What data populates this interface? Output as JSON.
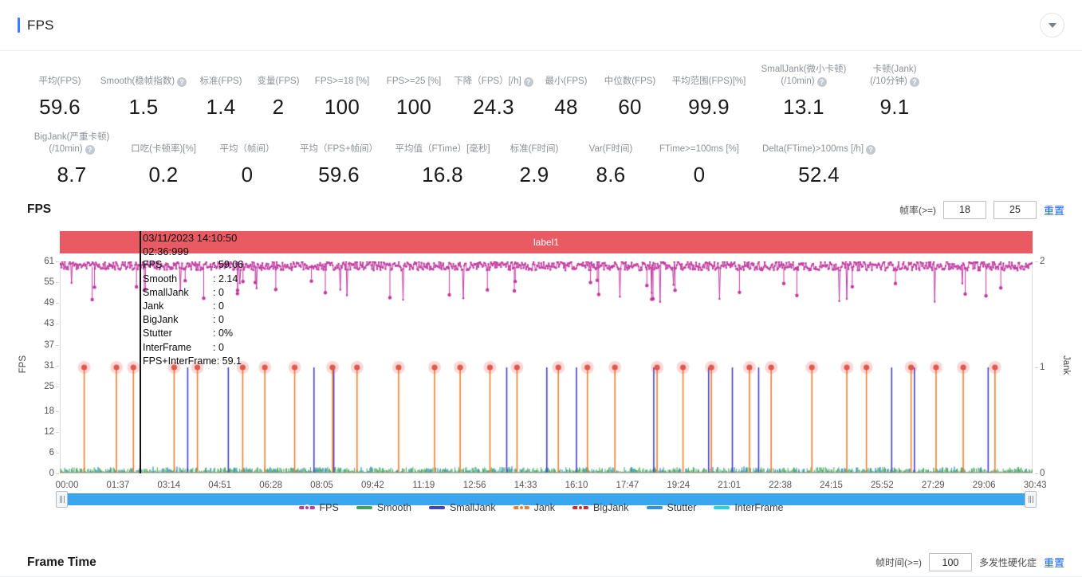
{
  "header": {
    "title": "FPS",
    "collapse_icon": "chevron-down-icon"
  },
  "stats": {
    "row1": [
      {
        "label_lines": [
          "平均(FPS)"
        ],
        "help": false,
        "value": "59.6"
      },
      {
        "label_lines": [
          "Smooth(稳帧指数)"
        ],
        "help": true,
        "value": "1.5"
      },
      {
        "label_lines": [
          "标准(FPS)"
        ],
        "help": false,
        "value": "1.4"
      },
      {
        "label_lines": [
          "变量(FPS)"
        ],
        "help": false,
        "value": "2"
      },
      {
        "label_lines": [
          "FPS>=18 [%]"
        ],
        "help": false,
        "value": "100"
      },
      {
        "label_lines": [
          "FPS>=25 [%]"
        ],
        "help": false,
        "value": "100"
      },
      {
        "label_lines": [
          "下降（FPS）[/h]"
        ],
        "help": true,
        "value": "24.3"
      },
      {
        "label_lines": [
          "最小(FPS)"
        ],
        "help": false,
        "value": "48"
      },
      {
        "label_lines": [
          "中位数(FPS)"
        ],
        "help": false,
        "value": "60"
      },
      {
        "label_lines": [
          "平均范围(FPS)[%]"
        ],
        "help": false,
        "value": "99.9"
      },
      {
        "label_lines": [
          "SmallJank(微小卡顿)",
          "(/10min)"
        ],
        "help": true,
        "value": "13.1"
      },
      {
        "label_lines": [
          "卡顿(Jank)",
          "(/10分钟)"
        ],
        "help": true,
        "value": "9.1"
      }
    ],
    "row2": [
      {
        "label_lines": [
          "BigJank(严重卡顿)",
          "(/10min)"
        ],
        "help": true,
        "value": "8.7"
      },
      {
        "label_lines": [
          "口吃(卡顿率)[%]"
        ],
        "help": false,
        "value": "0.2"
      },
      {
        "label_lines": [
          "平均（帧间）"
        ],
        "help": false,
        "value": "0"
      },
      {
        "label_lines": [
          "平均（FPS+帧间）"
        ],
        "help": false,
        "value": "59.6"
      },
      {
        "label_lines": [
          "平均值（FTime）[毫秒]"
        ],
        "help": false,
        "value": "16.8"
      },
      {
        "label_lines": [
          "标准(F时间)"
        ],
        "help": false,
        "value": "2.9"
      },
      {
        "label_lines": [
          "Var(F时间)"
        ],
        "help": false,
        "value": "8.6"
      },
      {
        "label_lines": [
          "FTime>=100ms [%]"
        ],
        "help": false,
        "value": "0"
      },
      {
        "label_lines": [
          "Delta(FTime)>100ms [/h]"
        ],
        "help": true,
        "value": "52.4"
      }
    ]
  },
  "fps_chart": {
    "section_title": "FPS",
    "filter_label": "帧率(>=)",
    "filter_value_1": "18",
    "filter_value_2": "25",
    "reset_label": "重置",
    "band_label": "label1",
    "tooltip": {
      "datetime": "03/11/2023 14:10:50",
      "elapsed": "02:36:999",
      "rows": [
        {
          "key": "FPS",
          "value": "59.06"
        },
        {
          "key": "Smooth",
          "value": "2.14"
        },
        {
          "key": "SmallJank",
          "value": "0"
        },
        {
          "key": "Jank",
          "value": "0"
        },
        {
          "key": "BigJank",
          "value": "0"
        },
        {
          "key": "Stutter",
          "value": "0%"
        },
        {
          "key": "InterFrame",
          "value": "0"
        }
      ],
      "last_row": "FPS+InterFrame: 59.1"
    },
    "legend": [
      {
        "name": "FPS",
        "color": "#c0399f",
        "style": "dot"
      },
      {
        "name": "Smooth",
        "color": "#3da35d",
        "style": "line"
      },
      {
        "name": "SmallJank",
        "color": "#4241c9",
        "style": "line"
      },
      {
        "name": "Jank",
        "color": "#f08030",
        "style": "dot"
      },
      {
        "name": "BigJank",
        "color": "#d12b2b",
        "style": "dot"
      },
      {
        "name": "Stutter",
        "color": "#2e93e8",
        "style": "line"
      },
      {
        "name": "InterFrame",
        "color": "#21d3e8",
        "style": "line"
      }
    ]
  },
  "frame_time": {
    "section_title": "Frame Time",
    "filter_label": "帧时间(>=)",
    "filter_value": "100",
    "ms_label": "多发性硬化症",
    "reset_label": "重置"
  },
  "chart_data": {
    "type": "line",
    "title": "FPS",
    "xlabel": "",
    "ylabel": "FPS",
    "y2label": "Jank",
    "ylim": [
      0,
      61
    ],
    "y2lim": [
      0,
      2
    ],
    "grid": false,
    "legend_position": "bottom",
    "yticks": [
      0,
      6,
      12,
      18,
      25,
      31,
      37,
      43,
      49,
      55,
      61
    ],
    "y2ticks": [
      0,
      1,
      2
    ],
    "xticks": [
      "00:00",
      "01:37",
      "03:14",
      "04:51",
      "06:28",
      "08:05",
      "09:42",
      "11:19",
      "12:56",
      "14:33",
      "16:10",
      "17:47",
      "19:24",
      "21:01",
      "22:38",
      "24:15",
      "25:52",
      "27:29",
      "29:06",
      "30:43"
    ],
    "annotation": {
      "marker_time": "02:36:999",
      "marker_datetime": "03/11/2023 14:10:50",
      "FPS": 59.06,
      "Smooth": 2.14,
      "SmallJank": 0,
      "Jank": 0,
      "BigJank": 0,
      "Stutter": "0%",
      "InterFrame": 0,
      "FPS_plus_InterFrame": 59.1
    },
    "series": [
      {
        "name": "FPS",
        "color": "#c0399f",
        "mean": 59.6,
        "min": 48,
        "median": 60
      },
      {
        "name": "Smooth",
        "color": "#3da35d",
        "mean": 1.5
      },
      {
        "name": "SmallJank",
        "color": "#4241c9",
        "rate_per_10min": 13.1
      },
      {
        "name": "Jank",
        "color": "#f08030",
        "rate_per_10min": 9.1
      },
      {
        "name": "BigJank",
        "color": "#d12b2b",
        "rate_per_10min": 8.7
      },
      {
        "name": "Stutter",
        "color": "#2e93e8",
        "percent": 0.2
      },
      {
        "name": "InterFrame",
        "color": "#21d3e8",
        "mean": 0
      }
    ]
  }
}
